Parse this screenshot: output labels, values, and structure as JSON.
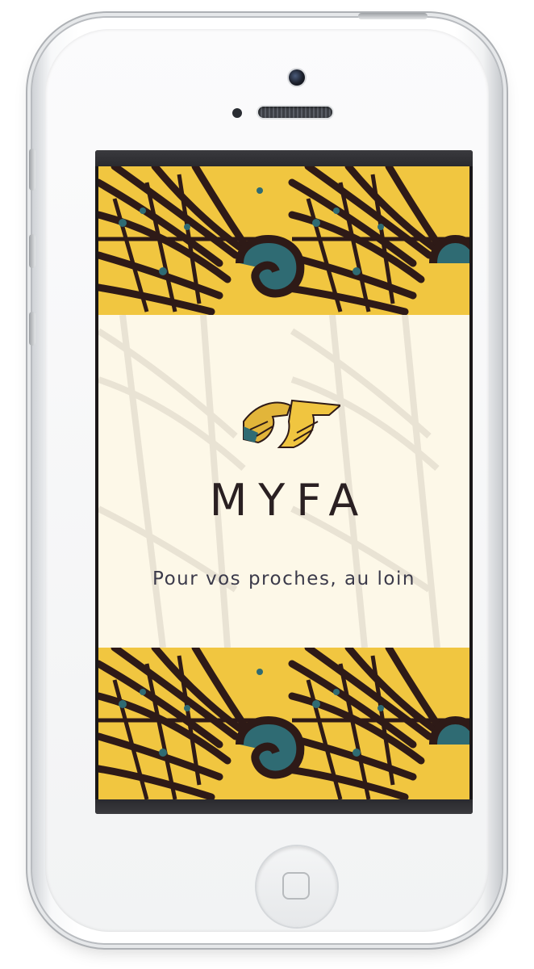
{
  "app": {
    "brand_name": "MYFA",
    "tagline": "Pour vos proches, au loin"
  },
  "device": {
    "model": "white-smartphone"
  },
  "colors": {
    "pattern_yellow": "#f1c640",
    "pattern_brown": "#2e1a17",
    "pattern_teal": "#2f6b73",
    "panel_cream": "#fdf8e8",
    "text_dark": "#2a2022"
  },
  "icons": {
    "logo": "myfa-hands-logo-icon"
  }
}
